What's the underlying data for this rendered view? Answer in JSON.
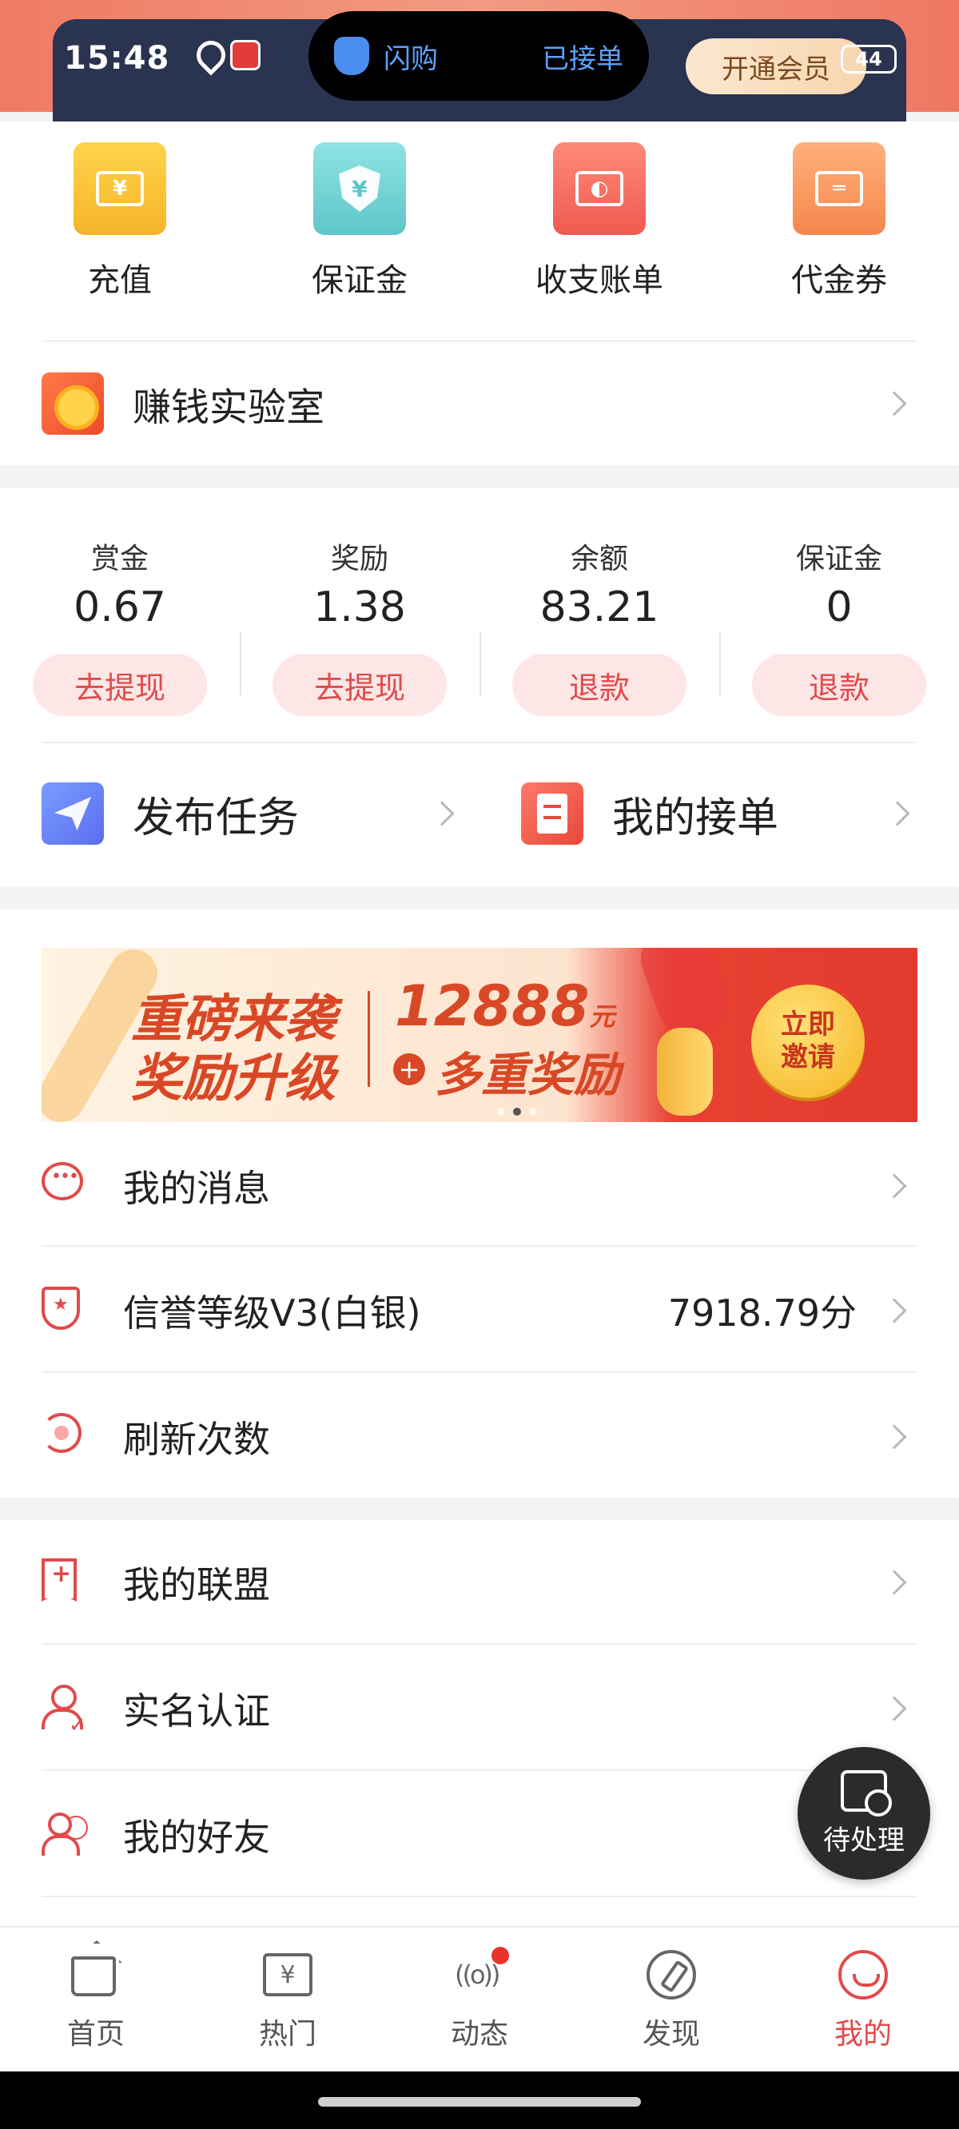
{
  "status_bar": {
    "time": "15:48",
    "battery": "44"
  },
  "island": {
    "left_label": "闪购",
    "right_label": "已接单"
  },
  "vip_button": "开通会员",
  "quick_actions": [
    {
      "icon": "yen-card-icon",
      "label": "充值"
    },
    {
      "icon": "shield-yen-icon",
      "label": "保证金"
    },
    {
      "icon": "wallet-icon",
      "label": "收支账单"
    },
    {
      "icon": "voucher-icon",
      "label": "代金券"
    }
  ],
  "lab": {
    "icon": "coin-icon",
    "label": "赚钱实验室"
  },
  "balances": [
    {
      "title": "赏金",
      "value": "0.67",
      "action": "去提现"
    },
    {
      "title": "奖励",
      "value": "1.38",
      "action": "去提现"
    },
    {
      "title": "余额",
      "value": "83.21",
      "action": "退款"
    },
    {
      "title": "保证金",
      "value": "0",
      "action": "退款"
    }
  ],
  "tasks": {
    "publish_label": "发布任务",
    "mine_label": "我的接单"
  },
  "banner": {
    "line1": "重磅来袭",
    "line2": "奖励升级",
    "amount": "12888",
    "unit": "元",
    "plus": "+",
    "multi": "多重奖励",
    "button_line1": "立即",
    "button_line2": "邀请"
  },
  "menu1": [
    {
      "icon": "message-icon",
      "label": "我的消息",
      "value": ""
    },
    {
      "icon": "shield-star-icon",
      "label": "信誉等级V3(白银)",
      "value": "7918.79分"
    },
    {
      "icon": "refresh-icon",
      "label": "刷新次数",
      "value": ""
    }
  ],
  "menu2": [
    {
      "icon": "bookmark-plus-icon",
      "label": "我的联盟"
    },
    {
      "icon": "user-check-icon",
      "label": "实名认证"
    },
    {
      "icon": "friends-icon",
      "label": "我的好友"
    }
  ],
  "fab": {
    "label": "待处理"
  },
  "bottom_nav": [
    {
      "icon": "home-icon",
      "label": "首页",
      "active": false
    },
    {
      "icon": "hot-icon",
      "label": "热门",
      "active": false
    },
    {
      "icon": "feed-icon",
      "label": "动态",
      "active": false
    },
    {
      "icon": "discover-icon",
      "label": "发现",
      "active": false
    },
    {
      "icon": "me-icon",
      "label": "我的",
      "active": true
    }
  ],
  "colors": {
    "accent": "#e24a4a",
    "header": "#2a3350",
    "soft_red": "#fde6e6"
  }
}
